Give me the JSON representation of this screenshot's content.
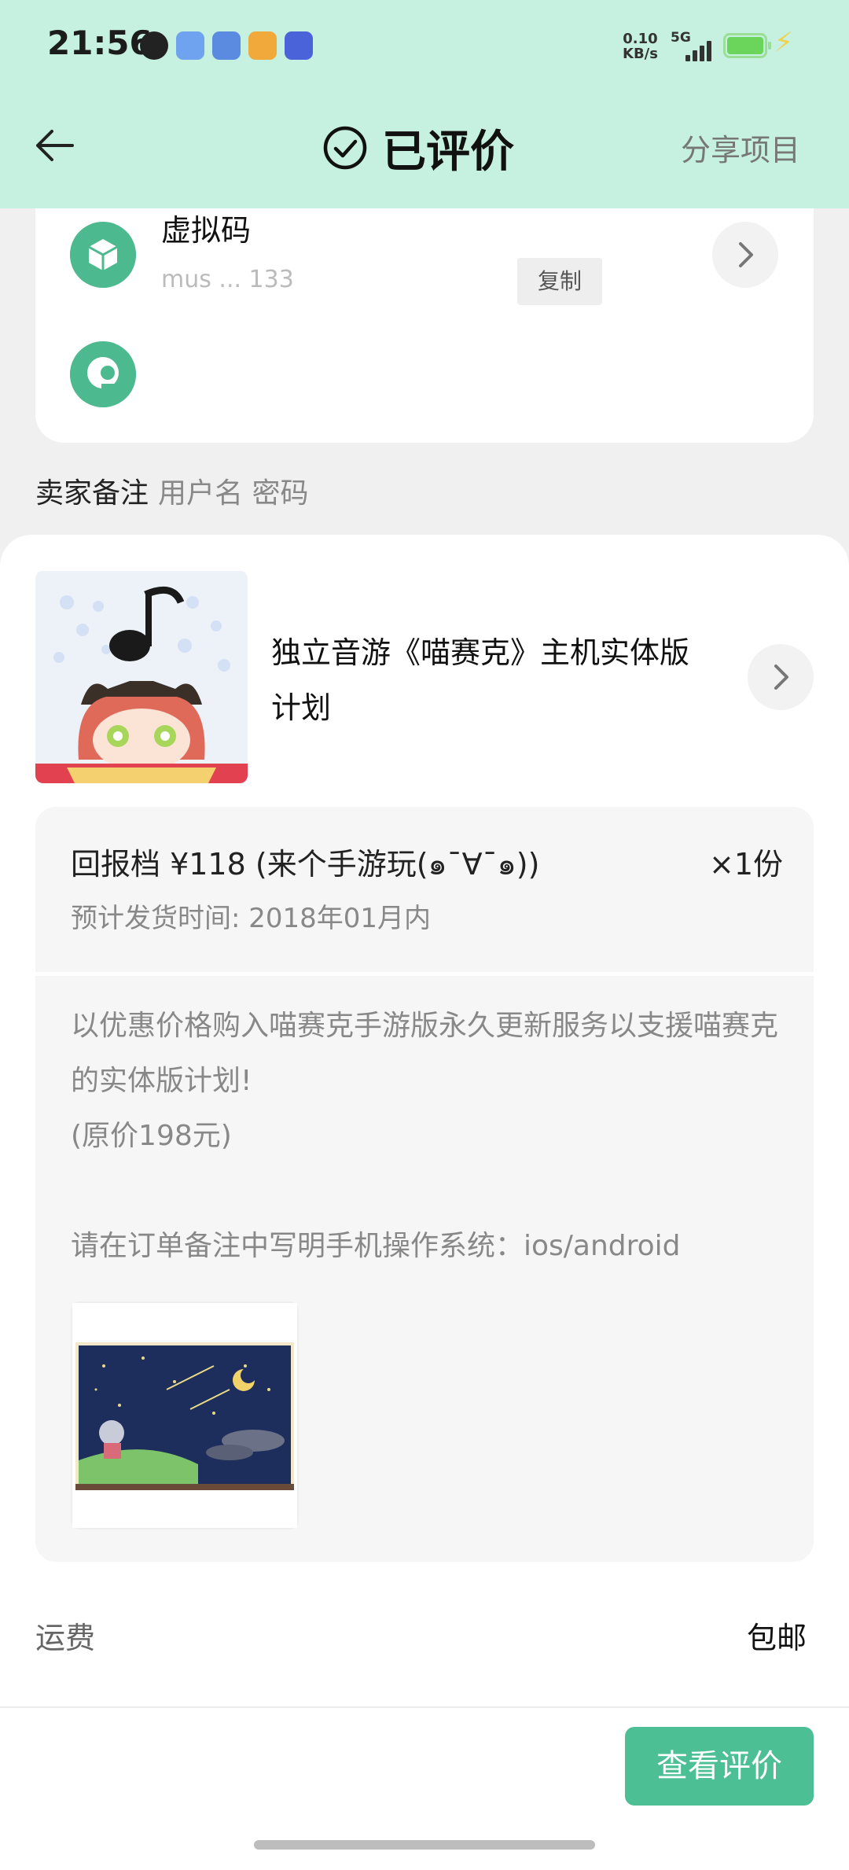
{
  "status_bar": {
    "time": "21:56",
    "net_speed_value": "0.10",
    "net_speed_unit": "KB/s",
    "network": "5G"
  },
  "header": {
    "title": "已评价",
    "share_label": "分享项目"
  },
  "virtual_code": {
    "label": "虚拟码",
    "code_partial": "mus                 ...   133",
    "copy_label": "复制"
  },
  "seller_note": {
    "label": "卖家备注",
    "value": "用户名 密码"
  },
  "project": {
    "title": "独立音游《喵赛克》主机实体版计划"
  },
  "tier": {
    "name": "回报档  ¥118 (来个手游玩(๑¯∀¯๑))",
    "quantity": "×1份",
    "ship_time": "预计发货时间:  2018年01月内",
    "description_lines": [
      "以优惠价格购入喵赛克手游版永久更新服务以支援喵赛克的实体版计划!",
      "(原价198元)",
      "",
      "请在订单备注中写明手机操作系统：ios/android"
    ]
  },
  "freight": {
    "label": "运费",
    "value": "包邮"
  },
  "actions": {
    "view_review_label": "查看评价"
  },
  "colors": {
    "header_bg": "#c6f0df",
    "accent_green": "#4cbf95",
    "icon_green": "#4cb98e"
  }
}
